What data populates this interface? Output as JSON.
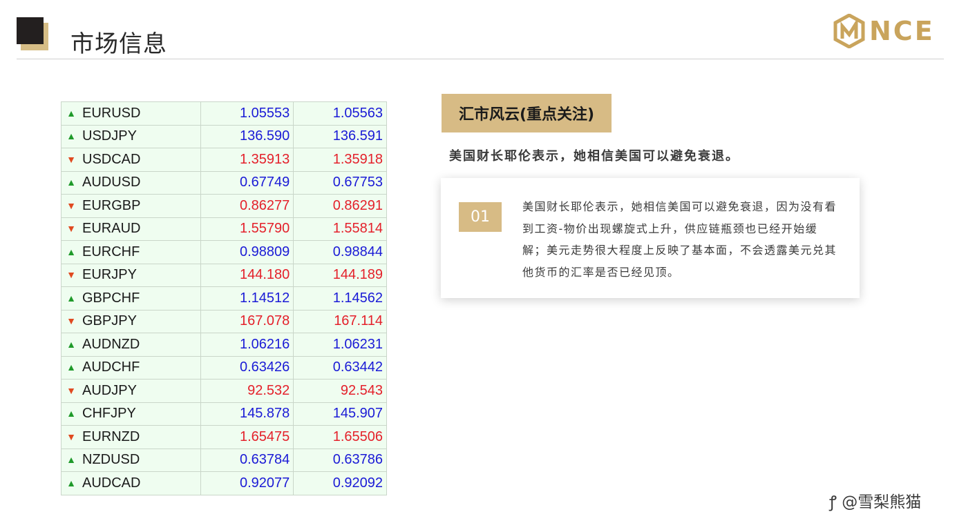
{
  "header": {
    "title": "市场信息",
    "logo_text": "NCE"
  },
  "rates": [
    {
      "symbol": "EURUSD",
      "dir": "up",
      "bid": "1.05553",
      "ask": "1.05563"
    },
    {
      "symbol": "USDJPY",
      "dir": "up",
      "bid": "136.590",
      "ask": "136.591"
    },
    {
      "symbol": "USDCAD",
      "dir": "down",
      "bid": "1.35913",
      "ask": "1.35918"
    },
    {
      "symbol": "AUDUSD",
      "dir": "up",
      "bid": "0.67749",
      "ask": "0.67753"
    },
    {
      "symbol": "EURGBP",
      "dir": "down",
      "bid": "0.86277",
      "ask": "0.86291"
    },
    {
      "symbol": "EURAUD",
      "dir": "down",
      "bid": "1.55790",
      "ask": "1.55814"
    },
    {
      "symbol": "EURCHF",
      "dir": "up",
      "bid": "0.98809",
      "ask": "0.98844"
    },
    {
      "symbol": "EURJPY",
      "dir": "down",
      "bid": "144.180",
      "ask": "144.189"
    },
    {
      "symbol": "GBPCHF",
      "dir": "up",
      "bid": "1.14512",
      "ask": "1.14562"
    },
    {
      "symbol": "GBPJPY",
      "dir": "down",
      "bid": "167.078",
      "ask": "167.114"
    },
    {
      "symbol": "AUDNZD",
      "dir": "up",
      "bid": "1.06216",
      "ask": "1.06231"
    },
    {
      "symbol": "AUDCHF",
      "dir": "up",
      "bid": "0.63426",
      "ask": "0.63442"
    },
    {
      "symbol": "AUDJPY",
      "dir": "down",
      "bid": "92.532",
      "ask": "92.543"
    },
    {
      "symbol": "CHFJPY",
      "dir": "up",
      "bid": "145.878",
      "ask": "145.907"
    },
    {
      "symbol": "EURNZD",
      "dir": "down",
      "bid": "1.65475",
      "ask": "1.65506"
    },
    {
      "symbol": "NZDUSD",
      "dir": "up",
      "bid": "0.63784",
      "ask": "0.63786"
    },
    {
      "symbol": "AUDCAD",
      "dir": "up",
      "bid": "0.92077",
      "ask": "0.92092"
    }
  ],
  "news": {
    "tag": "汇市风云(重点关注)",
    "headline": "美国财长耶伦表示，她相信美国可以避免衰退。",
    "item_number": "01",
    "body": "美国财长耶伦表示，她相信美国可以避免衰退，因为没有看到工资-物价出现螺旋式上升，供应链瓶颈也已经开始缓解；美元走势很大程度上反映了基本面，不会透露美元兑其他货币的汇率是否已经见顶。"
  },
  "watermark": "@雪梨熊猫",
  "colors": {
    "gold": "#d7bb85",
    "up_value": "#1a1ad6",
    "down_value": "#e4202a",
    "up_arrow": "#1f9a2a",
    "down_arrow": "#e04a20"
  },
  "icons": {
    "up": "up-arrow-icon",
    "down": "down-arrow-icon"
  }
}
